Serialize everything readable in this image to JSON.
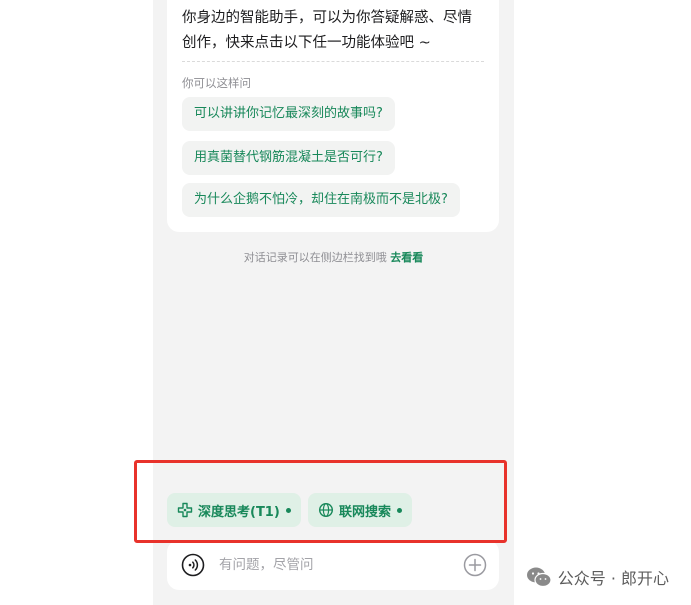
{
  "intro": {
    "text": "你身边的智能助手，可以为你答疑解惑、尽情创作，快来点击以下任一功能体验吧 ~"
  },
  "suggestions": {
    "label": "你可以这样问",
    "items": [
      "可以讲讲你记忆最深刻的故事吗?",
      "用真菌替代钢筋混凝土是否可行?",
      "为什么企鹅不怕冷，却住在南极而不是北极?"
    ]
  },
  "history": {
    "note": "对话记录可以在侧边栏找到哦",
    "link": "去看看"
  },
  "tools": {
    "deep_think": "深度思考(T1)",
    "web_search": "联网搜索"
  },
  "input": {
    "placeholder": "有问题，尽管问"
  },
  "watermark": {
    "text": "公众号 · 郎开心"
  },
  "colors": {
    "accent": "#18885a",
    "chip_bg": "#dff0e6",
    "highlight": "#e8322b"
  }
}
